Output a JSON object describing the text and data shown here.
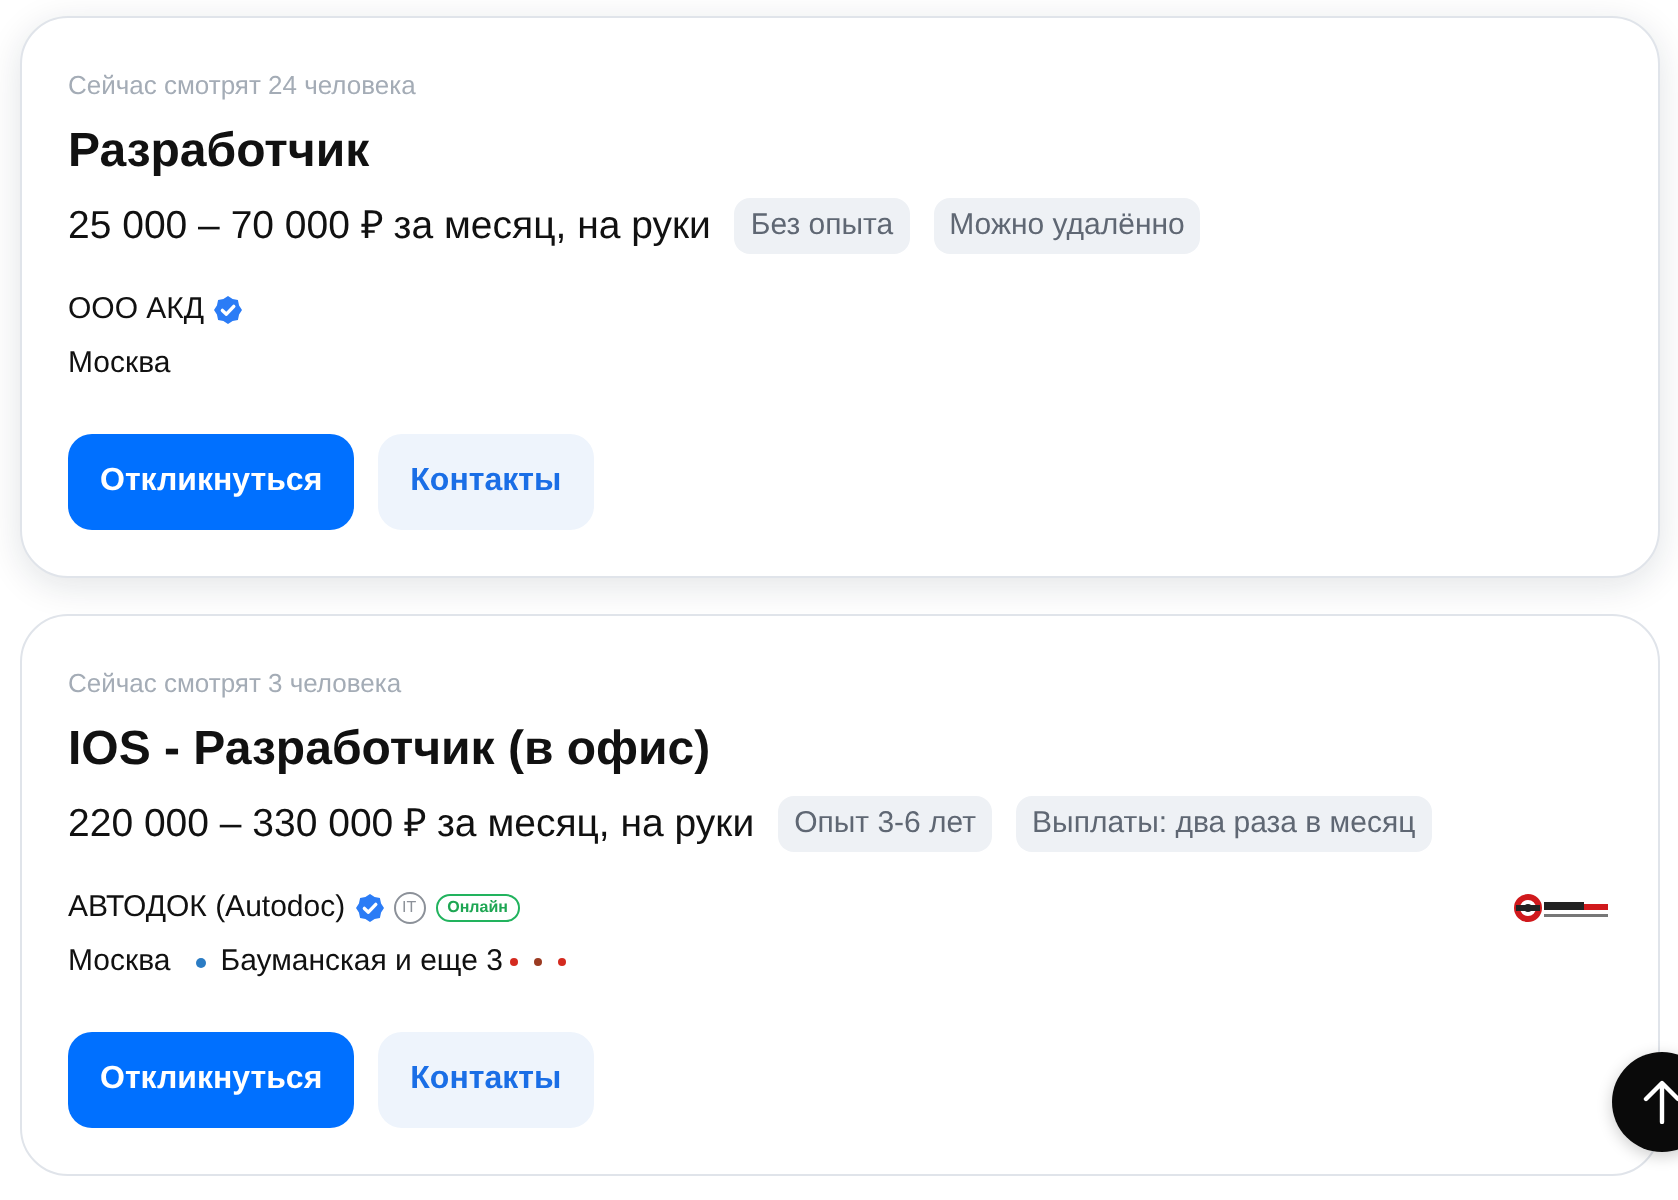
{
  "vacancies": [
    {
      "raised": true,
      "viewers": "Сейчас смотрят 24 человека",
      "title": "Разработчик",
      "salary": "25 000 – 70 000 ₽ за месяц, на руки",
      "tags": [
        "Без опыта",
        "Можно удалённо"
      ],
      "company": {
        "name": "ООО АКД",
        "verified": true
      },
      "logo": false,
      "location": "Москва",
      "buttons": [
        {
          "kind": "primary",
          "label": "Откликнуться"
        },
        {
          "kind": "secondary",
          "label": "Контакты"
        }
      ]
    },
    {
      "raised": false,
      "viewers": "Сейчас смотрят 3 человека",
      "title": "IOS - Разработчик (в офис)",
      "salary": "220 000 – 330 000 ₽ за месяц, на руки",
      "tags": [
        "Опыт 3-6 лет",
        "Выплаты: два раза в месяц"
      ],
      "company": {
        "name": "АВТОДОК (Autodoc)",
        "verified": true,
        "badges": [
          {
            "kind": "it",
            "label": "IT"
          },
          {
            "kind": "online",
            "label": "Онлайн"
          }
        ]
      },
      "logo": true,
      "location": "Москва",
      "metro": {
        "station": "Бауманская и еще 3",
        "color": "#2b7cc4",
        "more_lines": [
          {
            "color": "#d42a1f"
          },
          {
            "color": "#9b3b22"
          },
          {
            "color": "#d42a1f"
          }
        ]
      },
      "buttons": [
        {
          "kind": "primary",
          "label": "Откликнуться"
        },
        {
          "kind": "secondary",
          "label": "Контакты"
        }
      ]
    }
  ]
}
